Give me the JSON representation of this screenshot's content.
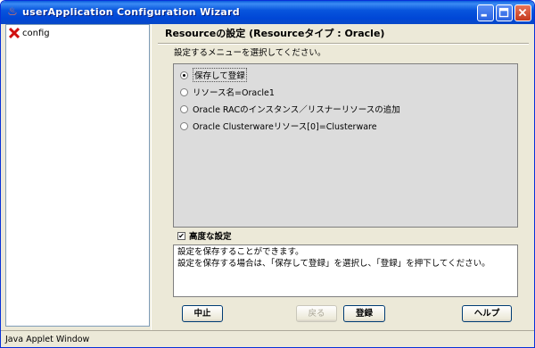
{
  "window": {
    "title": "userApplication Configuration Wizard",
    "status_bar": "Java Applet Window"
  },
  "tree": {
    "items": [
      {
        "label": "config",
        "icon": "red-x-error-icon"
      }
    ]
  },
  "panel": {
    "heading": "Resourceの設定 (Resourceタイプ : Oracle)",
    "instruction": "設定するメニューを選択してください。",
    "options": [
      {
        "label": "保存して登録",
        "selected": true
      },
      {
        "label": "リソース名=Oracle1",
        "selected": false
      },
      {
        "label": "Oracle RACのインスタンス／リスナーリソースの追加",
        "selected": false
      },
      {
        "label": "Oracle Clusterwareリソース[0]=Clusterware",
        "selected": false
      }
    ],
    "advanced_label": "高度な設定",
    "advanced_checked": true,
    "description_lines": [
      "設定を保存することができます。",
      "設定を保存する場合は、「保存して登録」を選択し、「登録」を押下してください。"
    ]
  },
  "buttons": {
    "cancel": "中止",
    "back": "戻る",
    "register": "登録",
    "help": "ヘルプ"
  },
  "colors": {
    "titlebar": "#0855dd",
    "window_bg": "#ece9d8",
    "options_bg": "#dcdcdc"
  }
}
